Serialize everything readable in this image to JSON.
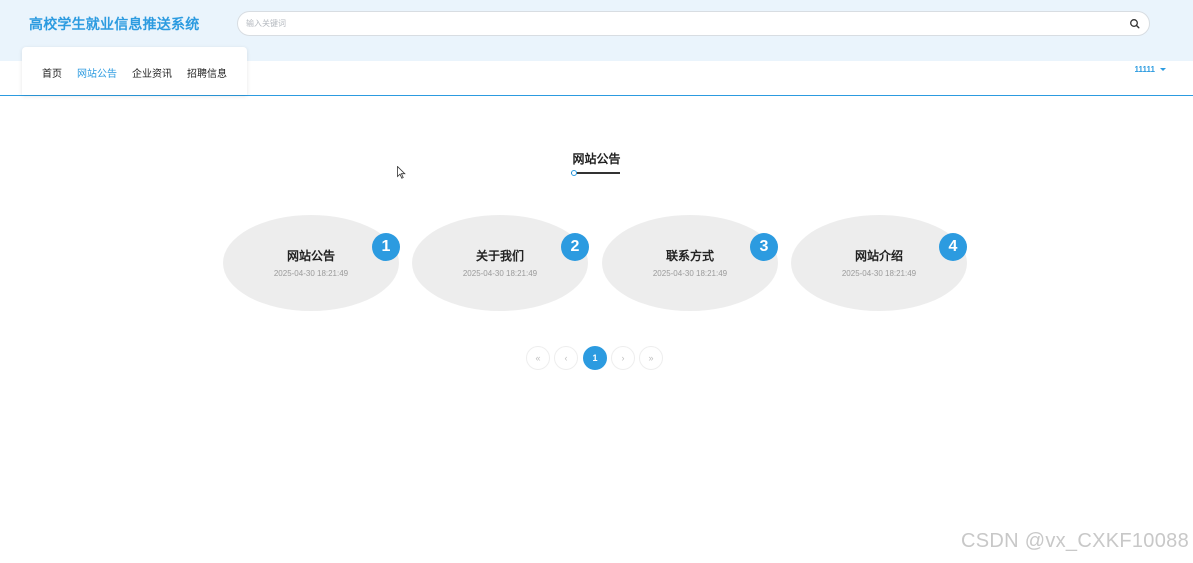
{
  "header": {
    "site_title": "高校学生就业信息推送系统",
    "search_placeholder": "输入关键词",
    "search_icon": "search-icon"
  },
  "nav": {
    "items": [
      {
        "label": "首页",
        "active": false
      },
      {
        "label": "网站公告",
        "active": true
      },
      {
        "label": "企业资讯",
        "active": false
      },
      {
        "label": "招聘信息",
        "active": false
      }
    ],
    "user": "11111"
  },
  "section": {
    "title": "网站公告"
  },
  "cards": [
    {
      "number": "1",
      "title": "网站公告",
      "date": "2025-04-30 18:21:49"
    },
    {
      "number": "2",
      "title": "关于我们",
      "date": "2025-04-30 18:21:49"
    },
    {
      "number": "3",
      "title": "联系方式",
      "date": "2025-04-30 18:21:49"
    },
    {
      "number": "4",
      "title": "网站介绍",
      "date": "2025-04-30 18:21:49"
    }
  ],
  "pagination": {
    "first": "«",
    "prev": "‹",
    "current": "1",
    "next": "›",
    "last": "»"
  },
  "watermark": "CSDN @vx_CXKF10088",
  "colors": {
    "accent": "#2c9be0",
    "header_bg": "#eaf4fc",
    "card_bg": "#ededed"
  }
}
